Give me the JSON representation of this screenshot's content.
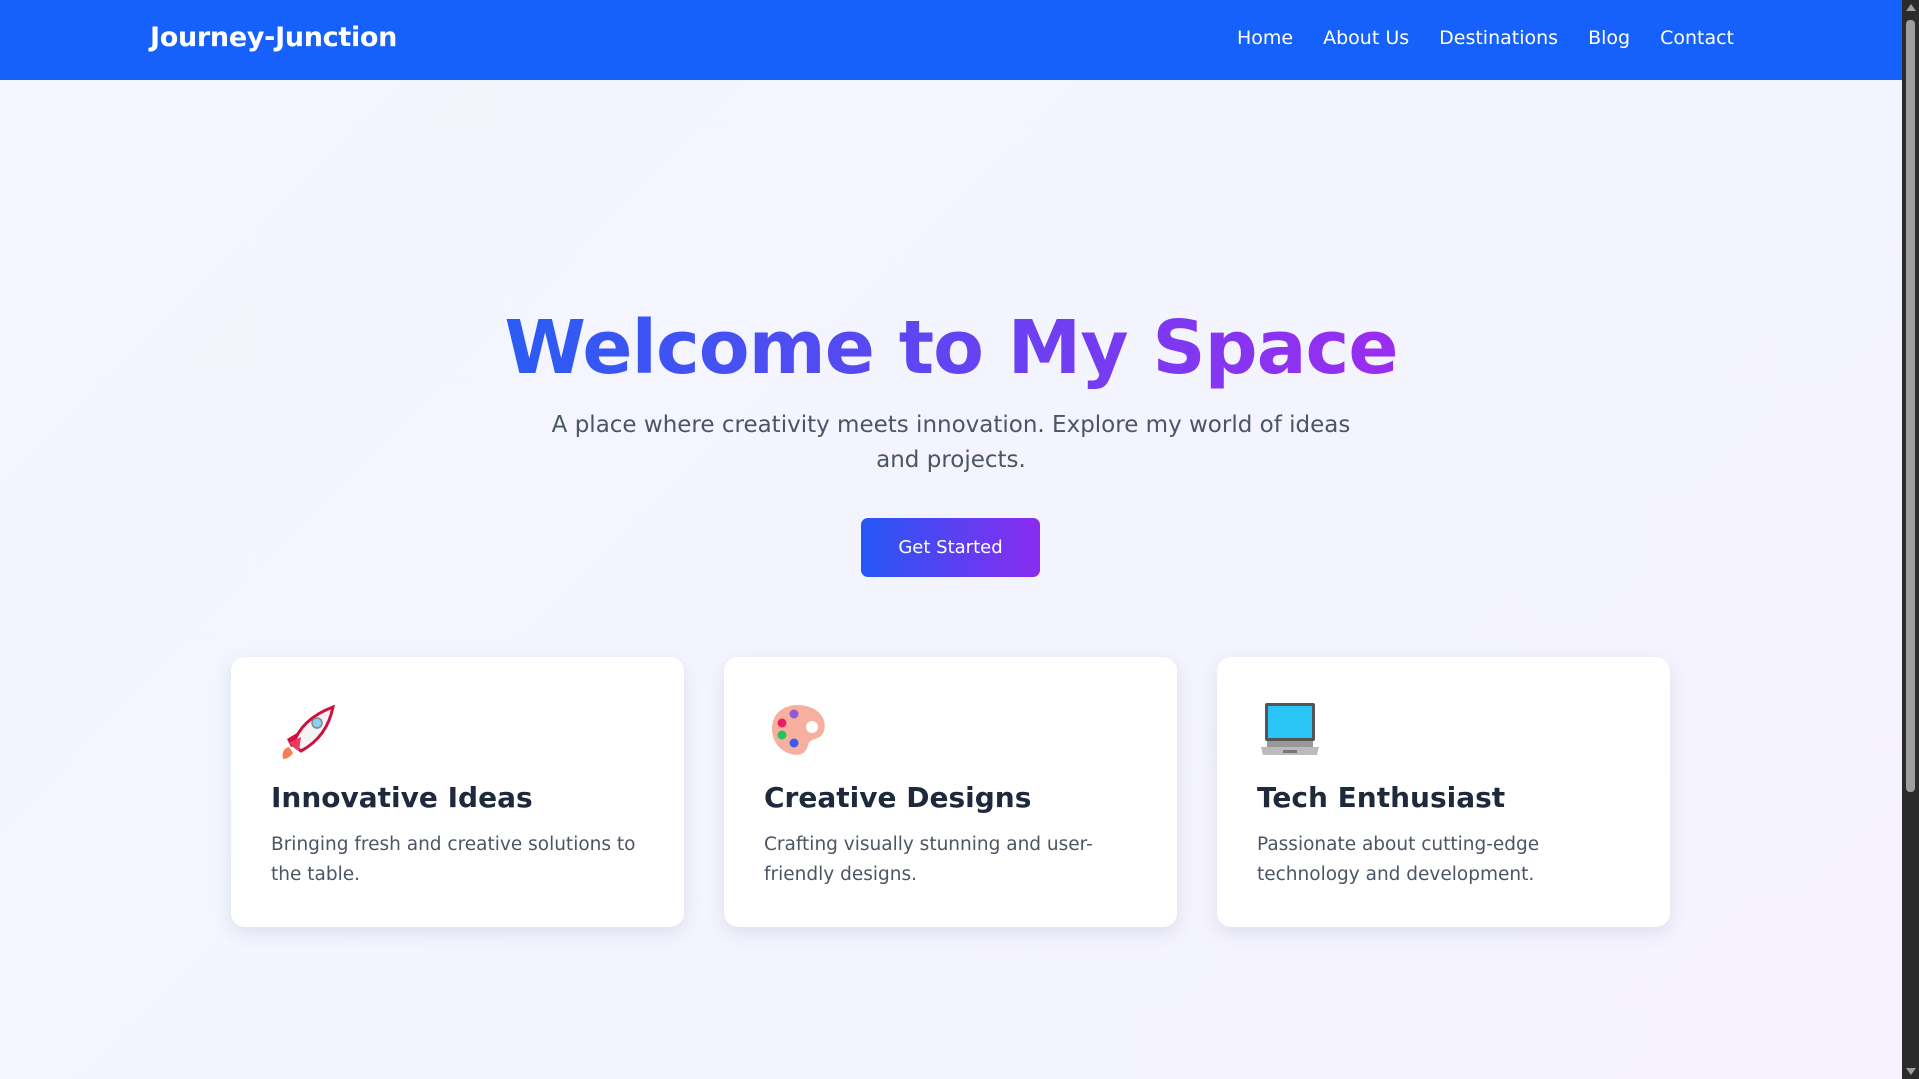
{
  "nav": {
    "logo": "Journey-Junction",
    "items": [
      "Home",
      "About Us",
      "Destinations",
      "Blog",
      "Contact"
    ],
    "color": "#1660fb"
  },
  "hero": {
    "title": "Welcome to My Space",
    "subtitle": "A place where creativity meets innovation. Explore my world of ideas and projects.",
    "cta": "Get Started"
  },
  "cards": [
    {
      "icon": "rocket-icon",
      "title": "Innovative Ideas",
      "text": "Bringing fresh and creative solutions to the table."
    },
    {
      "icon": "palette-icon",
      "title": "Creative Designs",
      "text": "Crafting visually stunning and user-friendly designs."
    },
    {
      "icon": "laptop-icon",
      "title": "Tech Enthusiast",
      "text": "Passionate about cutting-edge technology and development."
    }
  ]
}
